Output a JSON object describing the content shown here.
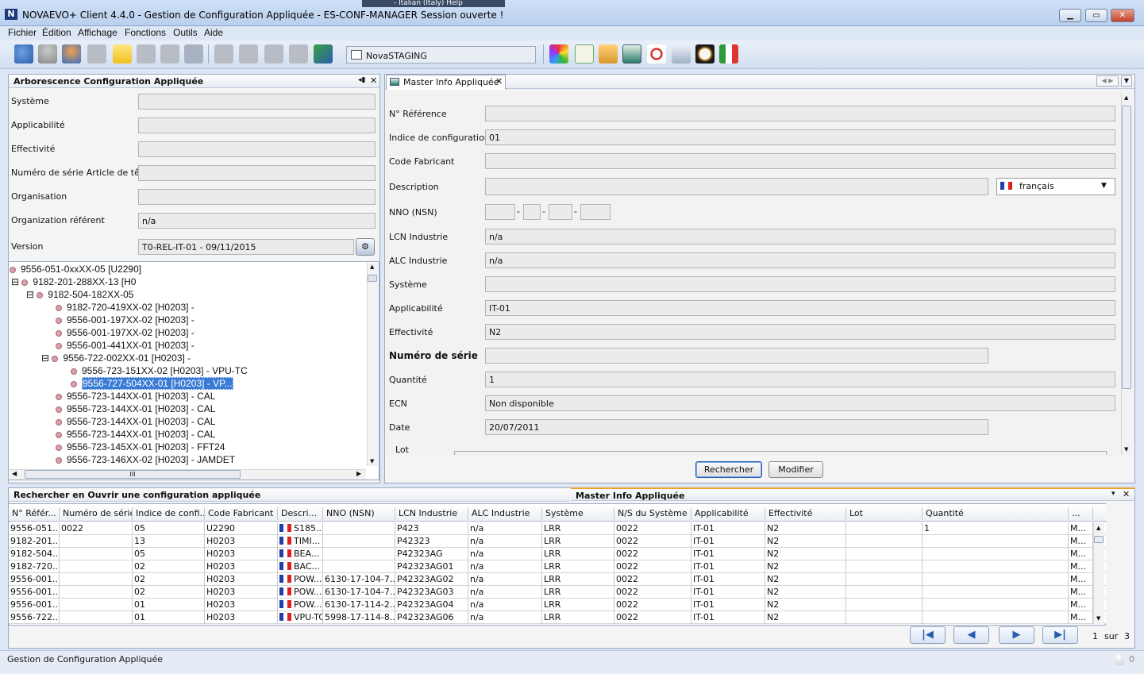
{
  "window": {
    "title": "NOVAEVO+ Client 4.4.0 - Gestion de Configuration Appliquée - ES-CONF-MANAGER Session ouverte !",
    "language_ghost": "- Italian (Italy)    Help"
  },
  "menu": [
    "Fichier",
    "Édition",
    "Affichage",
    "Fonctions",
    "Outils",
    "Aide"
  ],
  "toolbar": {
    "server": "NovaSTAGING"
  },
  "left_panel": {
    "title": "Arborescence Configuration Appliquée",
    "fields": [
      {
        "label": "Système",
        "value": ""
      },
      {
        "label": "Applicabilité",
        "value": ""
      },
      {
        "label": "Effectivité",
        "value": ""
      },
      {
        "label": "Numéro de série Article de tête",
        "value": ""
      },
      {
        "label": "Organisation",
        "value": ""
      },
      {
        "label": "Organization référent",
        "value": "n/a"
      },
      {
        "label": "Version",
        "value": "T0-REL-IT-01 - 09/11/2015"
      }
    ],
    "tree": [
      "9556-051-0xxXX-05 [U2290]",
      "9182-201-288XX-13 [H0",
      "9182-504-182XX-05",
      "9182-720-419XX-02 [H0203] -",
      "9556-001-197XX-02 [H0203] -",
      "9556-001-197XX-02 [H0203] -",
      "9556-001-441XX-01 [H0203] -",
      "9556-722-002XX-01 [H0203] -",
      "9556-723-151XX-02 [H0203] - VPU-TC",
      "9556-727-504XX-01 [H0203] - VP...",
      "9556-723-144XX-01 [H0203] - CAL",
      "9556-723-144XX-01 [H0203] - CAL",
      "9556-723-144XX-01 [H0203] - CAL",
      "9556-723-144XX-01 [H0203] - CAL",
      "9556-723-145XX-01 [H0203] - FFT24",
      "9556-723-146XX-02 [H0203] - JAMDET"
    ],
    "hscroll_glyph": "III"
  },
  "right_panel": {
    "tab": "Master Info Appliquée",
    "language": "français",
    "fields": [
      {
        "label": "N° Référence",
        "value": ""
      },
      {
        "label": "Indice de configuration",
        "value": "01"
      },
      {
        "label": "Code Fabricant",
        "value": ""
      },
      {
        "label": "Description",
        "value": ""
      },
      {
        "label": "NNO (NSN)",
        "value": ""
      },
      {
        "label": "LCN Industrie",
        "value": "n/a"
      },
      {
        "label": "ALC Industrie",
        "value": "n/a"
      },
      {
        "label": "Système",
        "value": ""
      },
      {
        "label": "Applicabilité",
        "value": "IT-01"
      },
      {
        "label": "Effectivité",
        "value": "N2"
      },
      {
        "label": "Numéro de série",
        "value": ""
      },
      {
        "label": "Quantité",
        "value": "1"
      },
      {
        "label": "ECN",
        "value": "Non disponible"
      },
      {
        "label": "Date",
        "value": "20/07/2011"
      },
      {
        "label": "Lot",
        "value": ""
      }
    ],
    "search_button": "Rechercher",
    "modify_button": "Modifier"
  },
  "bottom_panel": {
    "title_left": "Rechercher en Ouvrir une configuration appliquée",
    "title_right": "Master Info Appliquée",
    "columns": [
      "N° Référ...",
      "Numéro de série",
      "Indice de confi...",
      "Code Fabricant",
      "Descri...",
      "NNO (NSN)",
      "LCN Industrie",
      "ALC Industrie",
      "Système",
      "N/S du Système",
      "Applicabilité",
      "Effectivité",
      "Lot",
      "Quantité",
      "..."
    ],
    "rows": [
      [
        "9556-051...",
        "0022",
        "05",
        "U2290",
        "S185...",
        "",
        "P423",
        "n/a",
        "LRR",
        "0022",
        "IT-01",
        "N2",
        "",
        "1",
        "M..."
      ],
      [
        "9182-201...",
        "",
        "13",
        "H0203",
        "TIMI...",
        "",
        "P42323",
        "n/a",
        "LRR",
        "0022",
        "IT-01",
        "N2",
        "",
        "",
        "M..."
      ],
      [
        "9182-504...",
        "",
        "05",
        "H0203",
        "BEA...",
        "",
        "P42323AG",
        "n/a",
        "LRR",
        "0022",
        "IT-01",
        "N2",
        "",
        "",
        "M..."
      ],
      [
        "9182-720...",
        "",
        "02",
        "H0203",
        "BAC...",
        "",
        "P42323AG01",
        "n/a",
        "LRR",
        "0022",
        "IT-01",
        "N2",
        "",
        "",
        "M..."
      ],
      [
        "9556-001...",
        "",
        "02",
        "H0203",
        "POW...",
        "6130-17-104-7...",
        "P42323AG02",
        "n/a",
        "LRR",
        "0022",
        "IT-01",
        "N2",
        "",
        "",
        "M..."
      ],
      [
        "9556-001...",
        "",
        "02",
        "H0203",
        "POW...",
        "6130-17-104-7...",
        "P42323AG03",
        "n/a",
        "LRR",
        "0022",
        "IT-01",
        "N2",
        "",
        "",
        "M..."
      ],
      [
        "9556-001...",
        "",
        "01",
        "H0203",
        "POW...",
        "6130-17-114-2...",
        "P42323AG04",
        "n/a",
        "LRR",
        "0022",
        "IT-01",
        "N2",
        "",
        "",
        "M..."
      ],
      [
        "9556-722...",
        "",
        "01",
        "H0203",
        "VPU-TC",
        "5998-17-114-8...",
        "P42323AG06",
        "n/a",
        "LRR",
        "0022",
        "IT-01",
        "N2",
        "",
        "",
        "M..."
      ]
    ],
    "pager": {
      "current": "1",
      "sep": "sur",
      "total": "3"
    }
  },
  "statusbar": {
    "text": "Gestion de Configuration Appliquée",
    "count": "0"
  }
}
